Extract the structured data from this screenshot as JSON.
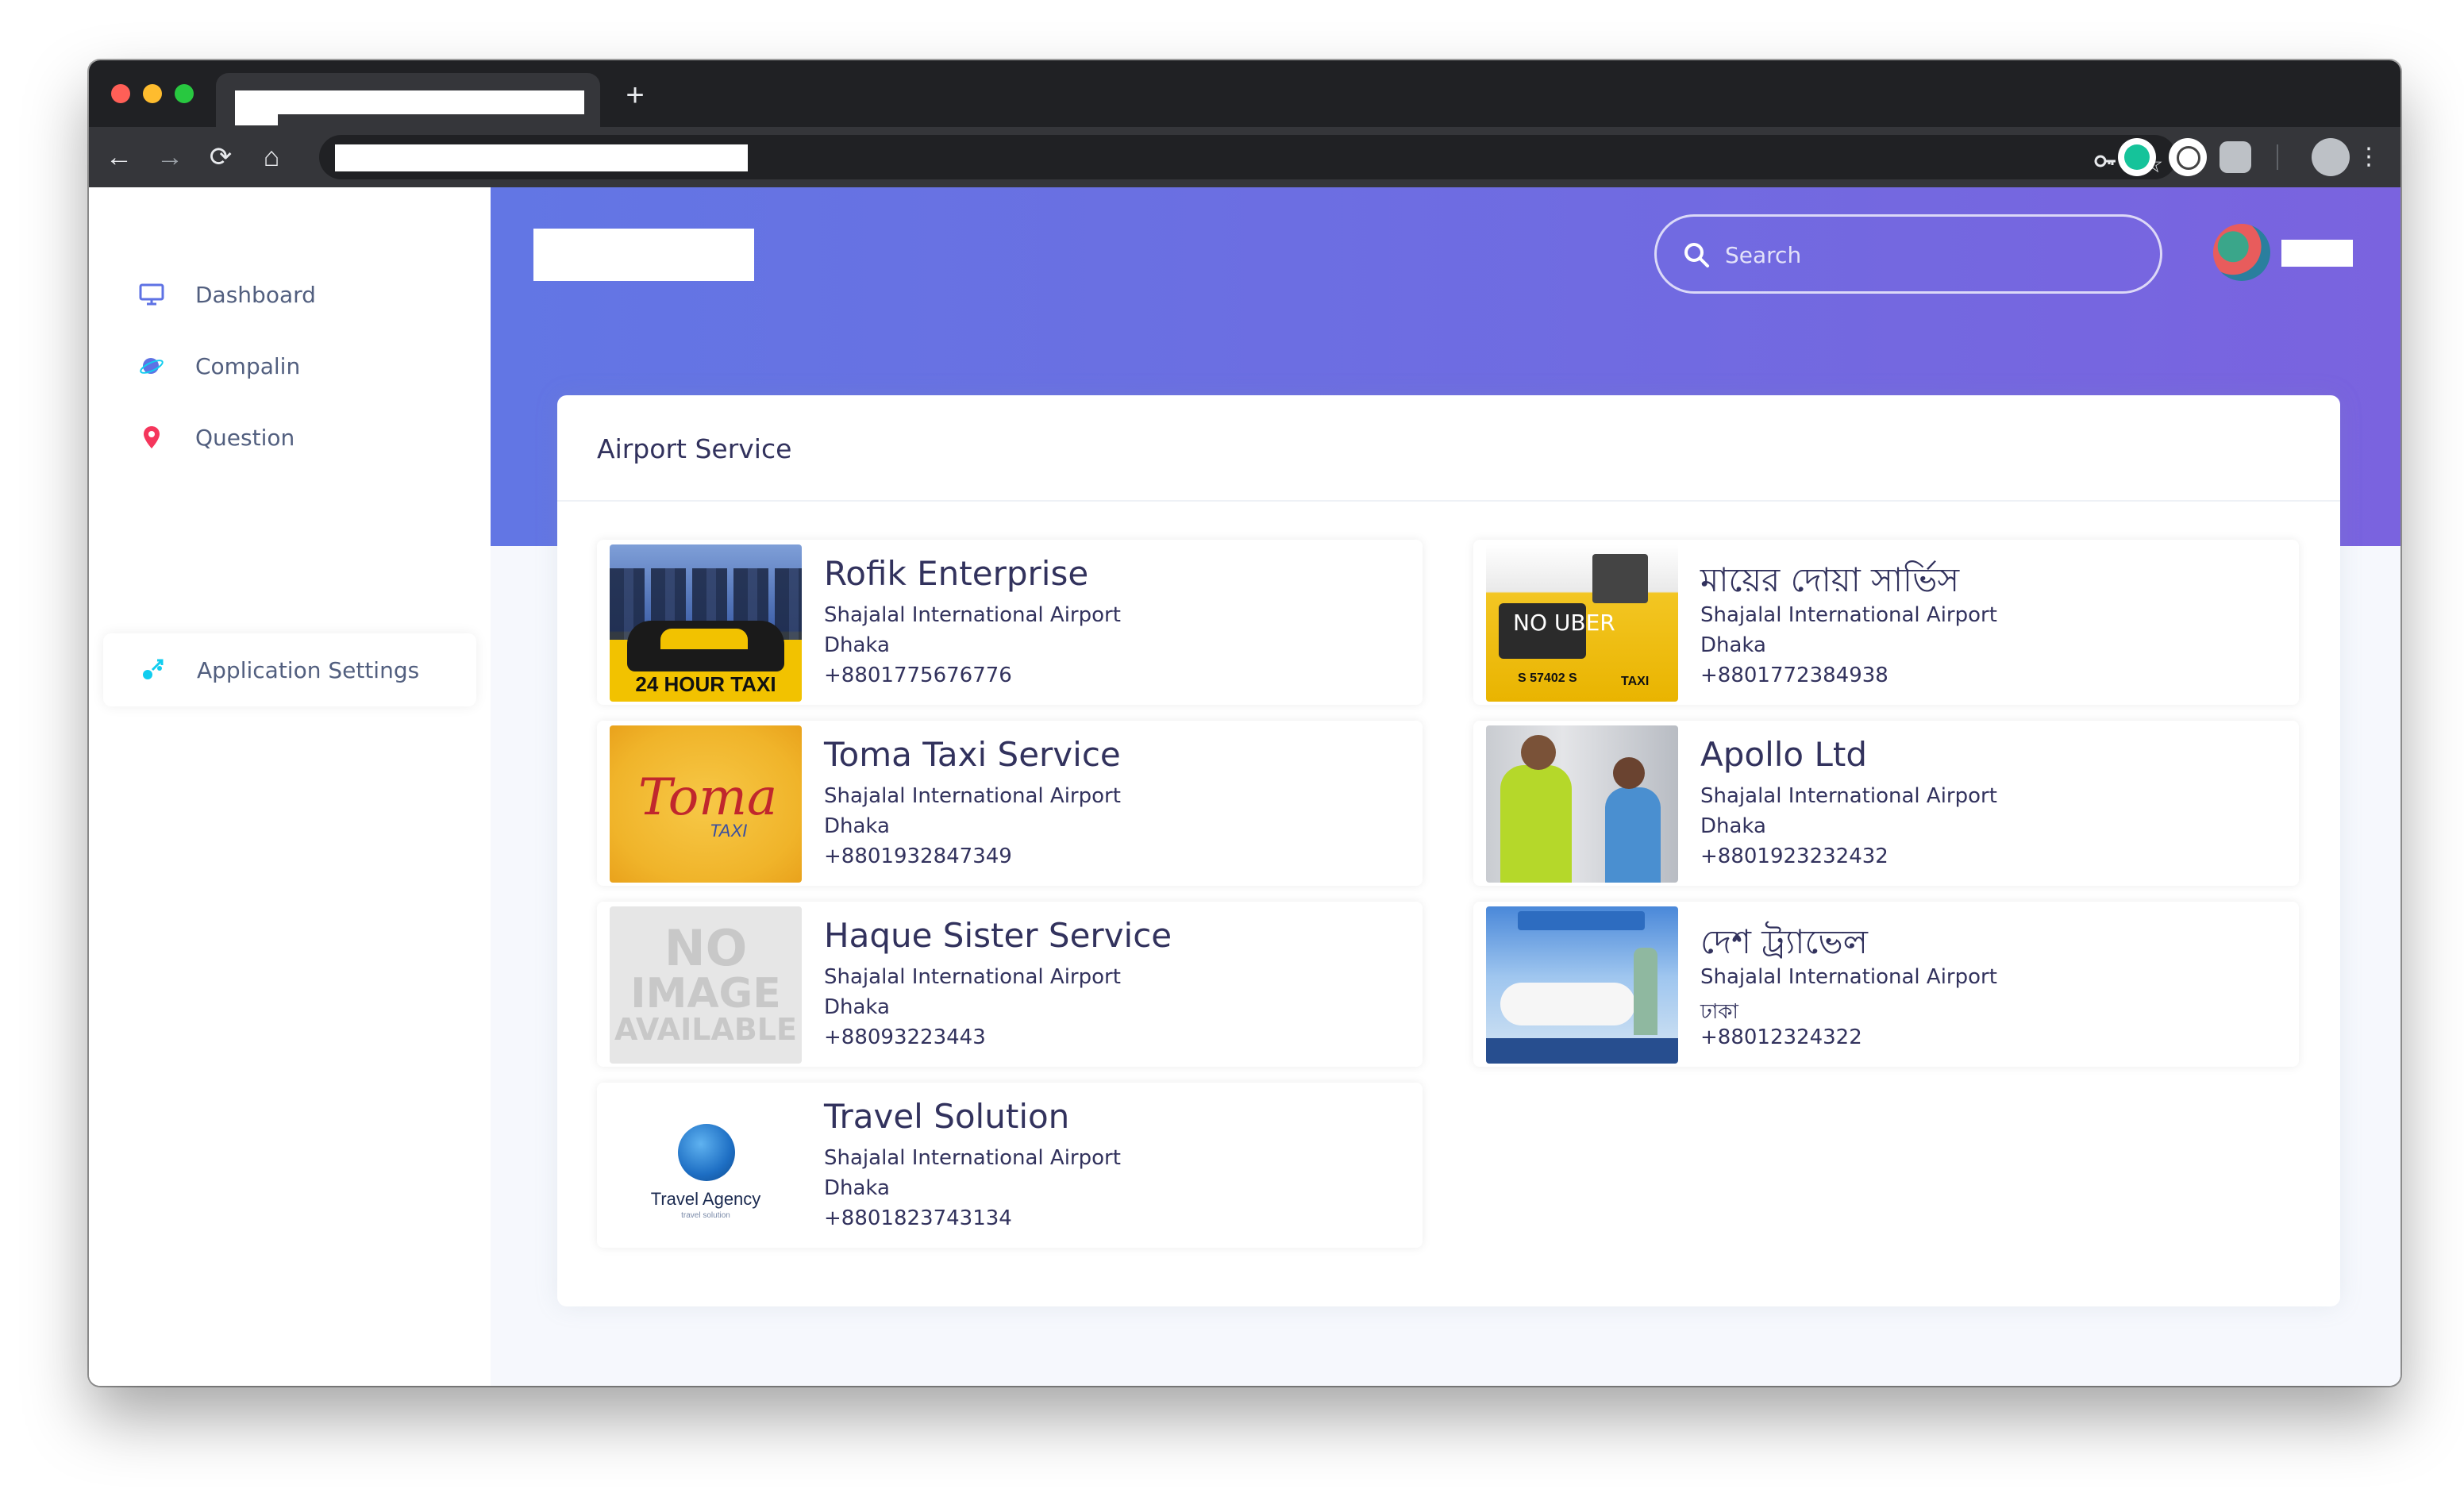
{
  "browser": {
    "new_tab_symbol": "+",
    "nav": {
      "back": "←",
      "forward": "→",
      "reload": "⟳",
      "home": "⌂"
    },
    "toolbar_icons": [
      "key-icon",
      "star-icon",
      "grammarly-icon",
      "twitter-icon",
      "extension-icon",
      "profile-icon",
      "kebab-menu-icon"
    ]
  },
  "sidebar": {
    "items": [
      {
        "label": "Dashboard",
        "icon": "monitor-icon",
        "color": "#5e72e4"
      },
      {
        "label": "Compalin",
        "icon": "planet-icon",
        "color": "#5e72e4"
      },
      {
        "label": "Question",
        "icon": "pin-icon",
        "color": "#f5365c"
      },
      {
        "label": "Application Settings",
        "icon": "settings-rocket-icon",
        "color": "#11cdef"
      }
    ]
  },
  "header": {
    "search": {
      "placeholder": "Search"
    },
    "gradient": [
      "#6276e4",
      "#7a63df"
    ]
  },
  "card": {
    "title": "Airport Service"
  },
  "services": [
    {
      "name": "Rofik Enterprise",
      "airport": "Shajalal International Airport",
      "city": "Dhaka",
      "phone": "+8801775676776",
      "thumb_caption": "24 HOUR TAXI"
    },
    {
      "name": "মায়ের দোয়া সার্ভিস",
      "airport": "Shajalal International Airport",
      "city": "Dhaka",
      "phone": "+8801772384938",
      "thumb_text": "NO UBER",
      "plate": "S 57402 S",
      "taxi": "TAXI"
    },
    {
      "name": "Toma Taxi Service",
      "airport": "Shajalal International Airport",
      "city": "Dhaka",
      "phone": "+8801932847349",
      "thumb_logo": "Toma",
      "thumb_sub": "TAXI"
    },
    {
      "name": "Apollo Ltd",
      "airport": "Shajalal International Airport",
      "city": "Dhaka",
      "phone": "+8801923232432"
    },
    {
      "name": "Haque Sister Service",
      "airport": "Shajalal International Airport",
      "city": "Dhaka",
      "phone": "+88093223443",
      "thumb_lines": [
        "NO",
        "IMAGE",
        "AVAILABLE"
      ]
    },
    {
      "name": "দেশ ট্র্যাভেল",
      "airport": "Shajalal International Airport",
      "city": "ঢাকা",
      "phone": "+88012324322"
    },
    {
      "name": "Travel Solution",
      "airport": "Shajalal International Airport",
      "city": "Dhaka",
      "phone": "+8801823743134",
      "thumb_label": "Travel Agency",
      "thumb_tiny": "travel solution"
    }
  ]
}
